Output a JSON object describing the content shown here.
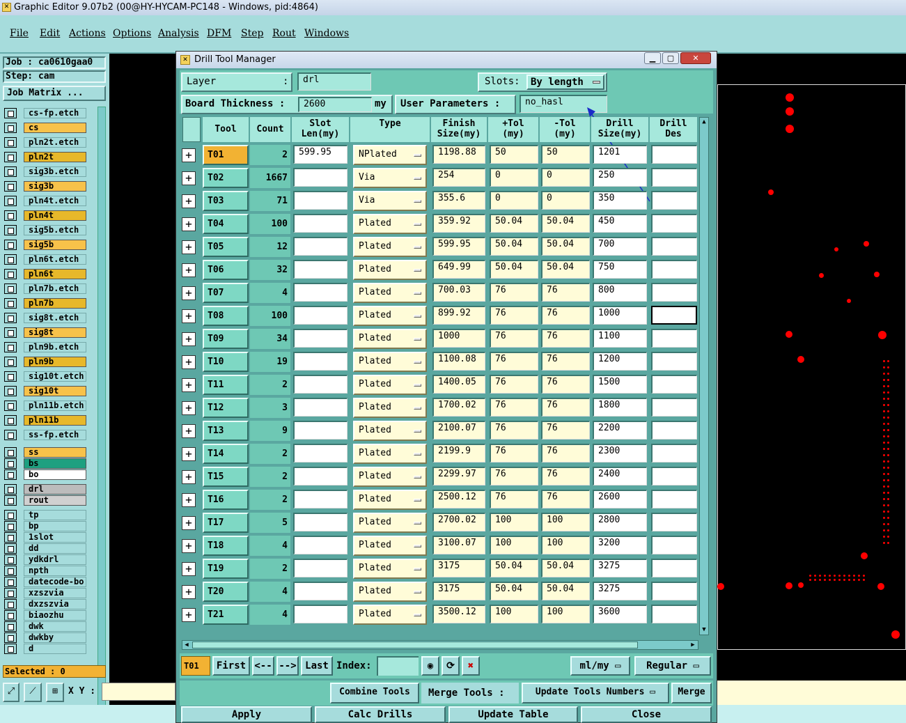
{
  "window": {
    "title": "Graphic Editor 9.07b2 (00@HY-HYCAM-PC148 - Windows, pid:4864)"
  },
  "menu": [
    "File",
    "Edit",
    "Actions",
    "Options",
    "Analysis",
    "DFM",
    "Step",
    "Rout",
    "Windows"
  ],
  "left": {
    "job_label": "Job : ca0610gaa0",
    "step_label": "Step: cam",
    "job_matrix": "Job Matrix ...",
    "selected": "Selected : 0",
    "xy_label": "X Y :",
    "layers_group1": [
      {
        "name": "cs-fp.etch",
        "color": "#a6dcdc"
      },
      {
        "name": "cs",
        "color": "#f7c24a"
      },
      {
        "name": "pln2t.etch",
        "color": "#a6dcdc"
      },
      {
        "name": "pln2t",
        "color": "#e7b82a"
      },
      {
        "name": "sig3b.etch",
        "color": "#a6dcdc"
      },
      {
        "name": "sig3b",
        "color": "#f7c24a"
      },
      {
        "name": "pln4t.etch",
        "color": "#a6dcdc"
      },
      {
        "name": "pln4t",
        "color": "#e7b82a"
      },
      {
        "name": "sig5b.etch",
        "color": "#a6dcdc"
      },
      {
        "name": "sig5b",
        "color": "#f7c24a"
      },
      {
        "name": "pln6t.etch",
        "color": "#a6dcdc"
      },
      {
        "name": "pln6t",
        "color": "#e7b82a"
      },
      {
        "name": "pln7b.etch",
        "color": "#a6dcdc"
      },
      {
        "name": "pln7b",
        "color": "#e7b82a"
      },
      {
        "name": "sig8t.etch",
        "color": "#a6dcdc"
      },
      {
        "name": "sig8t",
        "color": "#f7c24a"
      },
      {
        "name": "pln9b.etch",
        "color": "#a6dcdc"
      },
      {
        "name": "pln9b",
        "color": "#e7b82a"
      },
      {
        "name": "sig10t.etch",
        "color": "#a6dcdc"
      },
      {
        "name": "sig10t",
        "color": "#f7c24a"
      },
      {
        "name": "pln11b.etch",
        "color": "#a6dcdc"
      },
      {
        "name": "pln11b",
        "color": "#e7b82a"
      },
      {
        "name": "ss-fp.etch",
        "color": "#a6dcdc"
      }
    ],
    "layers_group2": [
      {
        "name": "ss",
        "color": "#f7c24a"
      },
      {
        "name": "bs",
        "color": "#1ea080"
      },
      {
        "name": "bo",
        "color": "#ffffff"
      }
    ],
    "layers_group3": [
      {
        "name": "drl",
        "color": "#bcbcbc"
      },
      {
        "name": "rout",
        "color": "#d0d0d0"
      }
    ],
    "layers_group4": [
      "tp",
      "bp",
      "1slot",
      "dd",
      "ydkdrl",
      "npth",
      "datecode-bo",
      "xzszvia",
      "dxzszvia",
      "biaozhu",
      "dwk",
      "dwkby",
      "d"
    ]
  },
  "dialog": {
    "title": "Drill Tool Manager",
    "layer_label": "Layer",
    "layer_colon": ":",
    "layer_value": "drl",
    "slots_label": "Slots:",
    "slots_value": "By length",
    "board_thickness_label": "Board Thickness :",
    "board_thickness_value": "2600",
    "board_thickness_unit": "my",
    "user_params_label": "User Parameters :",
    "user_params_value": "no_hasl",
    "columns": [
      "Tool",
      "Count",
      "Slot\nLen(my)",
      "Type",
      "Finish\nSize(my)",
      "+Tol\n(my)",
      "-Tol\n(my)",
      "Drill\nSize(my)",
      "Drill\nDes"
    ],
    "rows": [
      {
        "tool": "T01",
        "count": "2",
        "slot": "599.95",
        "type": "NPlated",
        "finish": "1198.88",
        "ptol": "50",
        "ntol": "50",
        "drill": "1201"
      },
      {
        "tool": "T02",
        "count": "1667",
        "slot": "",
        "type": "Via",
        "finish": "254",
        "ptol": "0",
        "ntol": "0",
        "drill": "250"
      },
      {
        "tool": "T03",
        "count": "71",
        "slot": "",
        "type": "Via",
        "finish": "355.6",
        "ptol": "0",
        "ntol": "0",
        "drill": "350"
      },
      {
        "tool": "T04",
        "count": "100",
        "slot": "",
        "type": "Plated",
        "finish": "359.92",
        "ptol": "50.04",
        "ntol": "50.04",
        "drill": "450"
      },
      {
        "tool": "T05",
        "count": "12",
        "slot": "",
        "type": "Plated",
        "finish": "599.95",
        "ptol": "50.04",
        "ntol": "50.04",
        "drill": "700"
      },
      {
        "tool": "T06",
        "count": "32",
        "slot": "",
        "type": "Plated",
        "finish": "649.99",
        "ptol": "50.04",
        "ntol": "50.04",
        "drill": "750"
      },
      {
        "tool": "T07",
        "count": "4",
        "slot": "",
        "type": "Plated",
        "finish": "700.03",
        "ptol": "76",
        "ntol": "76",
        "drill": "800"
      },
      {
        "tool": "T08",
        "count": "100",
        "slot": "",
        "type": "Plated",
        "finish": "899.92",
        "ptol": "76",
        "ntol": "76",
        "drill": "1000"
      },
      {
        "tool": "T09",
        "count": "34",
        "slot": "",
        "type": "Plated",
        "finish": "1000",
        "ptol": "76",
        "ntol": "76",
        "drill": "1100"
      },
      {
        "tool": "T10",
        "count": "19",
        "slot": "",
        "type": "Plated",
        "finish": "1100.08",
        "ptol": "76",
        "ntol": "76",
        "drill": "1200"
      },
      {
        "tool": "T11",
        "count": "2",
        "slot": "",
        "type": "Plated",
        "finish": "1400.05",
        "ptol": "76",
        "ntol": "76",
        "drill": "1500"
      },
      {
        "tool": "T12",
        "count": "3",
        "slot": "",
        "type": "Plated",
        "finish": "1700.02",
        "ptol": "76",
        "ntol": "76",
        "drill": "1800"
      },
      {
        "tool": "T13",
        "count": "9",
        "slot": "",
        "type": "Plated",
        "finish": "2100.07",
        "ptol": "76",
        "ntol": "76",
        "drill": "2200"
      },
      {
        "tool": "T14",
        "count": "2",
        "slot": "",
        "type": "Plated",
        "finish": "2199.9",
        "ptol": "76",
        "ntol": "76",
        "drill": "2300"
      },
      {
        "tool": "T15",
        "count": "2",
        "slot": "",
        "type": "Plated",
        "finish": "2299.97",
        "ptol": "76",
        "ntol": "76",
        "drill": "2400"
      },
      {
        "tool": "T16",
        "count": "2",
        "slot": "",
        "type": "Plated",
        "finish": "2500.12",
        "ptol": "76",
        "ntol": "76",
        "drill": "2600"
      },
      {
        "tool": "T17",
        "count": "5",
        "slot": "",
        "type": "Plated",
        "finish": "2700.02",
        "ptol": "100",
        "ntol": "100",
        "drill": "2800"
      },
      {
        "tool": "T18",
        "count": "4",
        "slot": "",
        "type": "Plated",
        "finish": "3100.07",
        "ptol": "100",
        "ntol": "100",
        "drill": "3200"
      },
      {
        "tool": "T19",
        "count": "2",
        "slot": "",
        "type": "Plated",
        "finish": "3175",
        "ptol": "50.04",
        "ntol": "50.04",
        "drill": "3275"
      },
      {
        "tool": "T20",
        "count": "4",
        "slot": "",
        "type": "Plated",
        "finish": "3175",
        "ptol": "50.04",
        "ntol": "50.04",
        "drill": "3275"
      },
      {
        "tool": "T21",
        "count": "4",
        "slot": "",
        "type": "Plated",
        "finish": "3500.12",
        "ptol": "100",
        "ntol": "100",
        "drill": "3600"
      }
    ],
    "nav": {
      "current": "T01",
      "first": "First",
      "prev": "<--",
      "next": "-->",
      "last": "Last",
      "index_label": "Index:",
      "units": "ml/my",
      "mode": "Regular"
    },
    "actions": {
      "combine": "Combine Tools",
      "merge_tools": "Merge Tools :",
      "update_numbers": "Update Tools Numbers",
      "merge": "Merge"
    },
    "footer": {
      "apply": "Apply",
      "calc": "Calc Drills",
      "update": "Update Table",
      "close": "Close"
    }
  }
}
